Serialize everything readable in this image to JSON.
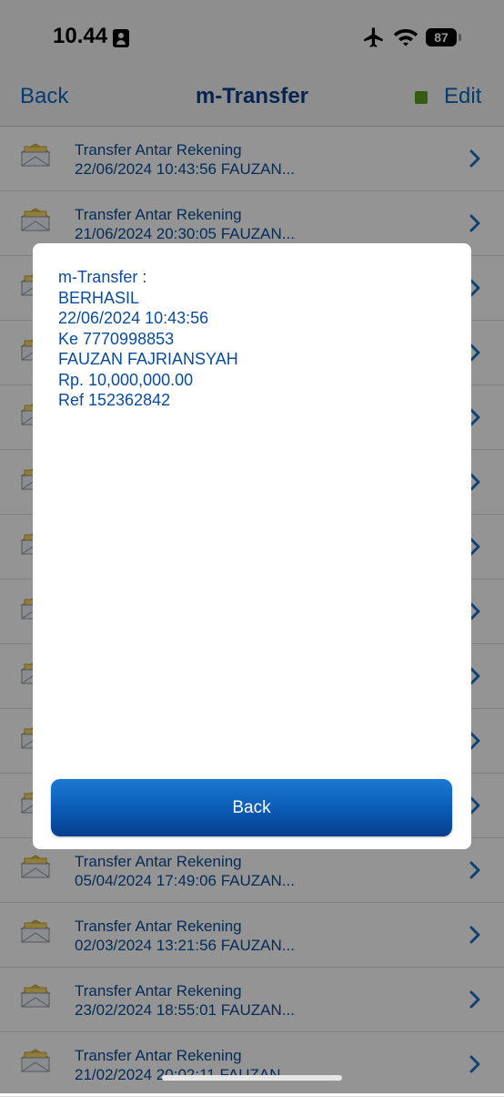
{
  "status_bar": {
    "time": "10.44",
    "battery": "87"
  },
  "nav": {
    "back_label": "Back",
    "title": "m-Transfer",
    "edit_label": "Edit"
  },
  "list": [
    {
      "title": "Transfer Antar Rekening",
      "subtitle": "22/06/2024 10:43:56 FAUZAN..."
    },
    {
      "title": "Transfer Antar Rekening",
      "subtitle": "21/06/2024 20:30:05 FAUZAN..."
    },
    {
      "title": "",
      "subtitle": ""
    },
    {
      "title": "",
      "subtitle": ""
    },
    {
      "title": "",
      "subtitle": ""
    },
    {
      "title": "",
      "subtitle": ""
    },
    {
      "title": "",
      "subtitle": ""
    },
    {
      "title": "",
      "subtitle": ""
    },
    {
      "title": "",
      "subtitle": ""
    },
    {
      "title": "",
      "subtitle": ""
    },
    {
      "title": "",
      "subtitle": ""
    },
    {
      "title": "Transfer Antar Rekening",
      "subtitle": "05/04/2024 17:49:06 FAUZAN..."
    },
    {
      "title": "Transfer Antar Rekening",
      "subtitle": "02/03/2024 13:21:56 FAUZAN..."
    },
    {
      "title": "Transfer Antar Rekening",
      "subtitle": "23/02/2024 18:55:01 FAUZAN..."
    },
    {
      "title": "Transfer Antar Rekening",
      "subtitle": "21/02/2024 20:02:11 FAUZAN..."
    }
  ],
  "dialog": {
    "lines": [
      "m-Transfer :",
      "BERHASIL",
      "22/06/2024 10:43:56",
      "Ke 7770998853",
      "FAUZAN FAJRIANSYAH",
      "Rp. 10,000,000.00",
      "Ref 152362842"
    ],
    "button_label": "Back"
  },
  "colors": {
    "accent": "#0b66c2",
    "title": "#0a3f8a",
    "text": "#0a4c9a",
    "indicator": "#5aa01e"
  },
  "icons": [
    "contact-card-icon",
    "airplane-icon",
    "wifi-icon",
    "battery-icon",
    "envelope-icon",
    "chevron-right-icon"
  ]
}
